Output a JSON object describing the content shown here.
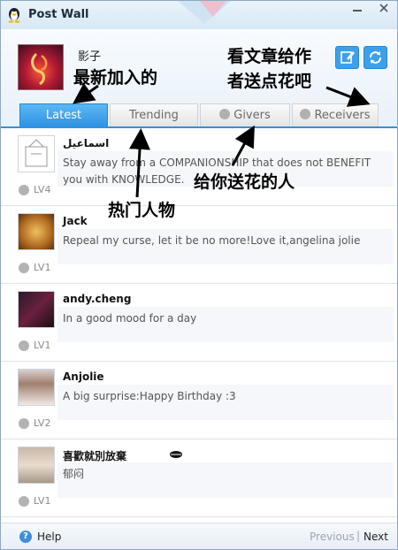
{
  "window": {
    "title": "Post Wall"
  },
  "profile": {
    "username": "影子"
  },
  "tabs": [
    {
      "label": "Latest",
      "active": true
    },
    {
      "label": "Trending",
      "active": false
    },
    {
      "label": "Givers",
      "active": false
    },
    {
      "label": "Receivers",
      "active": false
    }
  ],
  "annotations": {
    "latest": "最新加入的",
    "article_giver_line1": "看文章给作",
    "article_giver_line2": "者送点花吧",
    "trending": "热门人物",
    "givers": "给你送花的人"
  },
  "posts": [
    {
      "name": "اسماعيل",
      "text": "Stay away from a COMPANIONSHIP that does not BENEFIT you with KNOWLEDGE.",
      "level": "LV4"
    },
    {
      "name": "Jack",
      "text": "Repeal my curse, let it be no more!Love it,angelina jolie",
      "level": "LV1"
    },
    {
      "name": "andy.cheng",
      "text": "In a good mood for a day",
      "level": "LV1"
    },
    {
      "name": "Anjolie",
      "text": "A big surprise:Happy Birthday :3",
      "level": "LV2"
    },
    {
      "name": "喜歡就別放棄",
      "text": "郁闷",
      "level": "LV1"
    }
  ],
  "footer": {
    "help": "Help",
    "previous": "Previous",
    "separator": "|",
    "next": "Next"
  },
  "colors": {
    "accent": "#2f93e3",
    "tab_active_text": "#ffffff"
  },
  "icons": [
    "qq-penguin-icon",
    "edit-icon",
    "refresh-icon",
    "flower-icon",
    "help-icon"
  ]
}
